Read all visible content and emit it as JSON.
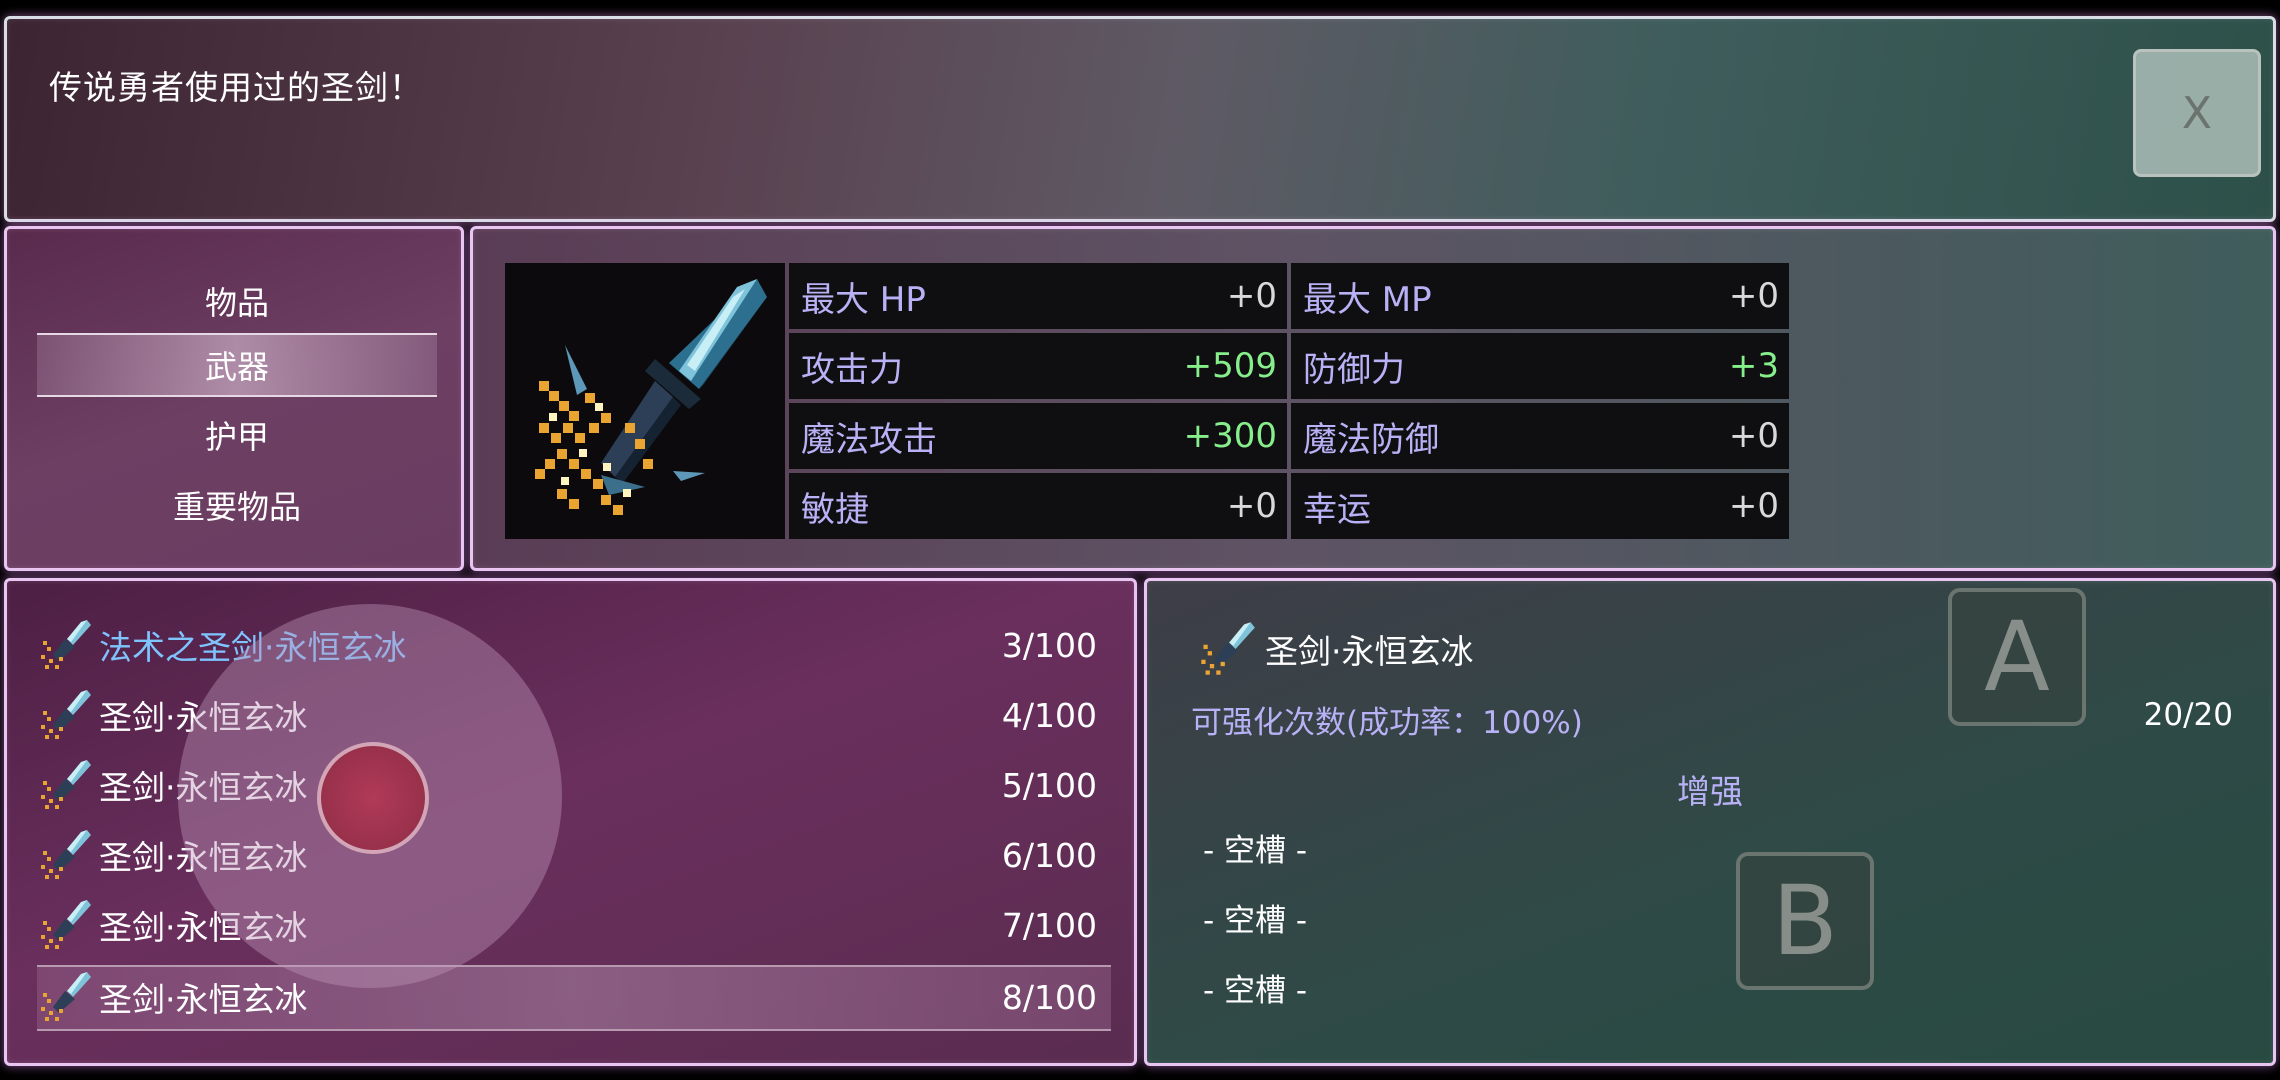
{
  "help": {
    "text": "传说勇者使用过的圣剑！"
  },
  "close_button": {
    "label": "X"
  },
  "categories": [
    {
      "label": "物品"
    },
    {
      "label": "武器"
    },
    {
      "label": "护甲"
    },
    {
      "label": "重要物品"
    }
  ],
  "selected_category": "武器",
  "stats": {
    "max_hp": {
      "label": "最大 HP",
      "value": "+0"
    },
    "max_mp": {
      "label": "最大 MP",
      "value": "+0"
    },
    "attack": {
      "label": "攻击力",
      "value": "+509"
    },
    "defense": {
      "label": "防御力",
      "value": "+3"
    },
    "magic_attack": {
      "label": "魔法攻击",
      "value": "+300"
    },
    "magic_defense": {
      "label": "魔法防御",
      "value": "+0"
    },
    "agility": {
      "label": "敏捷",
      "value": "+0"
    },
    "luck": {
      "label": "幸运",
      "value": "+0"
    }
  },
  "weapon_list": [
    {
      "name": "法术之圣剑·永恒玄冰",
      "count": "3/100"
    },
    {
      "name": "圣剑·永恒玄冰",
      "count": "4/100"
    },
    {
      "name": "圣剑·永恒玄冰",
      "count": "5/100"
    },
    {
      "name": "圣剑·永恒玄冰",
      "count": "6/100"
    },
    {
      "name": "圣剑·永恒玄冰",
      "count": "7/100"
    },
    {
      "name": "圣剑·永恒玄冰",
      "count": "8/100"
    }
  ],
  "selected_row_index": 5,
  "detail": {
    "name": "圣剑·永恒玄冰",
    "enhance_rate_label": "可强化次数(成功率：100%)",
    "enhance_rate_value": "20/20",
    "enhance_title": "增强",
    "slots": [
      "- 空槽 -",
      "- 空槽 -",
      "- 空槽 -"
    ]
  },
  "overlay_buttons": {
    "a": "A",
    "b": "B"
  },
  "icons": {
    "weapon": "ice-sword-icon",
    "close": "close-icon"
  },
  "colors": {
    "stat_label": "#b8b1f5",
    "stat_increase": "#86ee8a",
    "highlight_name": "#7fc4ff"
  }
}
